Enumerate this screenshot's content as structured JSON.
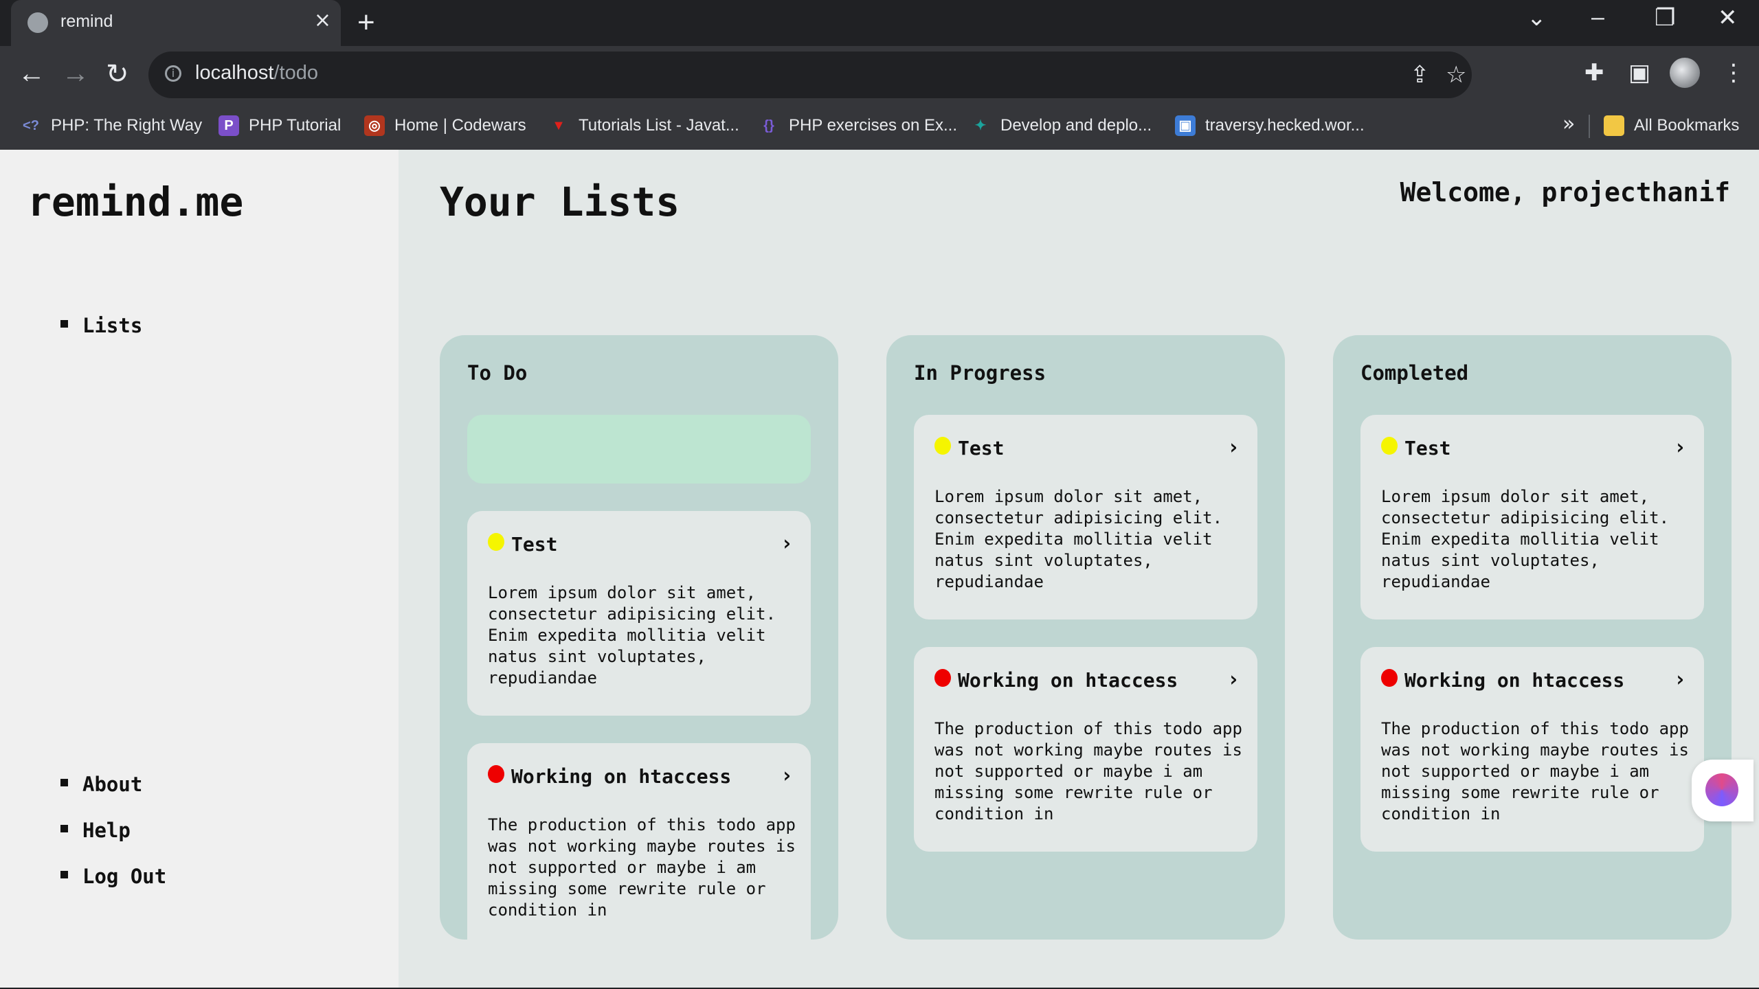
{
  "browser": {
    "tab_title": "remind",
    "tab_close": "×",
    "new_tab": "+",
    "url_host": "localhost",
    "url_path": "/todo",
    "bookmarks": [
      {
        "label": "PHP: The Right Way",
        "icon": "<?",
        "color": "#4f5b93"
      },
      {
        "label": "PHP Tutorial",
        "icon": "P",
        "color": "#7b4fc9"
      },
      {
        "label": "Home | Codewars",
        "icon": "◎",
        "color": "#b1361e"
      },
      {
        "label": "Tutorials List - Javat...",
        "icon": "▼",
        "color": "#e0201b"
      },
      {
        "label": "PHP exercises on Ex...",
        "icon": "{}",
        "color": "#5b3fa0"
      },
      {
        "label": "Develop and deplo...",
        "icon": "✦",
        "color": "#1ba39c"
      },
      {
        "label": "traversy.hecked.wor...",
        "icon": "▣",
        "color": "#3d7cd6"
      }
    ],
    "bookmarks_more": "»",
    "all_bookmarks": "All Bookmarks"
  },
  "app": {
    "brand": "remind.me",
    "nav_top": [
      "Lists"
    ],
    "nav_bottom": [
      "About",
      "Help",
      "Log Out"
    ],
    "page_title": "Your Lists",
    "welcome": "Welcome, projecthanif"
  },
  "columns": [
    {
      "title": "To Do",
      "cards": [
        {
          "title": "Test",
          "priority_color": "#f5f500",
          "body": "Lorem ipsum dolor sit amet, consectetur adipisicing elit. Enim expedita mollitia velit natus sint voluptates, repudiandae"
        },
        {
          "title": "Working on htaccess",
          "priority_color": "#ee0000",
          "body": "The production of this todo app was not working maybe routes is not supported or maybe i am missing some rewrite rule or condition in"
        }
      ]
    },
    {
      "title": "In Progress",
      "cards": [
        {
          "title": "Test",
          "priority_color": "#f5f500",
          "body": "Lorem ipsum dolor sit amet, consectetur adipisicing elit. Enim expedita mollitia velit natus sint voluptates, repudiandae"
        },
        {
          "title": "Working on htaccess",
          "priority_color": "#ee0000",
          "body": "The production of this todo app was not working maybe routes is not supported or maybe i am missing some rewrite rule or condition in"
        }
      ]
    },
    {
      "title": "Completed",
      "cards": [
        {
          "title": "Test",
          "priority_color": "#f5f500",
          "body": "Lorem ipsum dolor sit amet, consectetur adipisicing elit. Enim expedita mollitia velit natus sint voluptates, repudiandae"
        },
        {
          "title": "Working on htaccess",
          "priority_color": "#ee0000",
          "body": "The production of this todo app was not working maybe routes is not supported or maybe i am missing some rewrite rule or condition in"
        }
      ]
    }
  ],
  "card_chevron": "›",
  "colors": {
    "page_bg": "#e3e8e7",
    "sidebar_bg": "#f0f0f0",
    "column_bg": "#bfd6d2",
    "add_slot_bg": "#bde5d1"
  }
}
